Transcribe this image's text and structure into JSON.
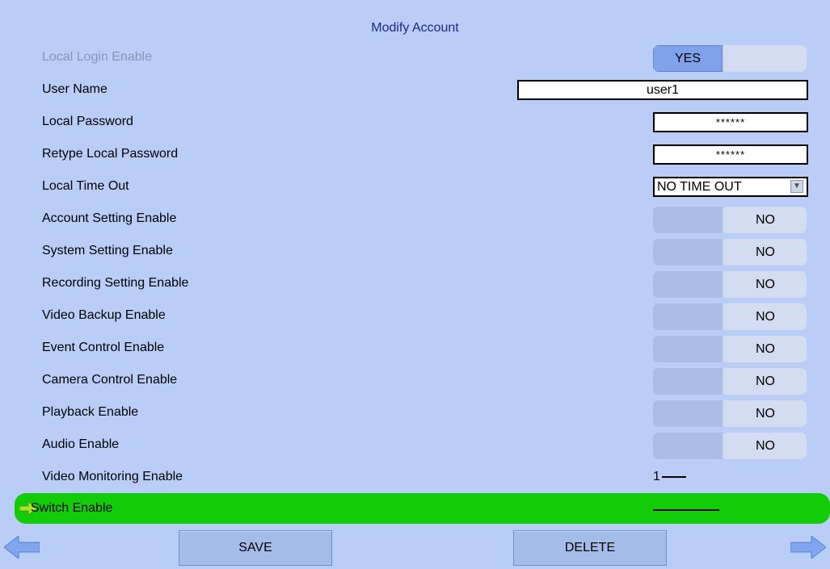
{
  "title": "Modify Account",
  "rows": [
    {
      "label": "Local Login Enable",
      "yes": "YES"
    },
    {
      "label": "User Name",
      "value": "user1"
    },
    {
      "label": "Local Password",
      "value": "******"
    },
    {
      "label": "Retype Local Password",
      "value": "******"
    },
    {
      "label": "Local Time Out",
      "value": "NO TIME OUT"
    },
    {
      "label": "Account Setting Enable",
      "no": "NO"
    },
    {
      "label": "System Setting Enable",
      "no": "NO"
    },
    {
      "label": "Recording Setting Enable",
      "no": "NO"
    },
    {
      "label": "Video Backup Enable",
      "no": "NO"
    },
    {
      "label": "Event Control Enable",
      "no": "NO"
    },
    {
      "label": "Camera Control Enable",
      "no": "NO"
    },
    {
      "label": "Playback Enable",
      "no": "NO"
    },
    {
      "label": "Audio Enable",
      "no": "NO"
    },
    {
      "label": "Video Monitoring Enable",
      "value": "1"
    },
    {
      "label": "Switch Enable"
    }
  ],
  "buttons": {
    "save": "SAVE",
    "delete": "DELETE"
  },
  "colors": {
    "background": "#b9cdf7",
    "highlight": "#12cc0a",
    "accent": "#7fa2ea"
  },
  "icons": {
    "pointer": "green-arrow-icon",
    "prev": "left-arrow-icon",
    "next": "right-arrow-icon"
  }
}
